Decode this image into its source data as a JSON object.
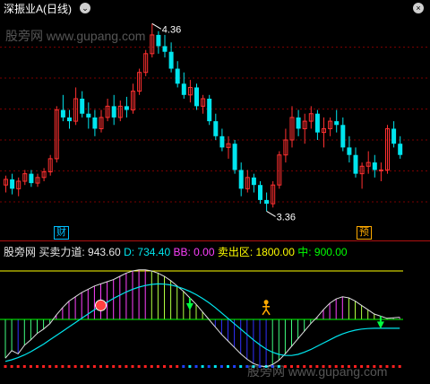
{
  "title": {
    "symbol": "深振业A",
    "period": "(日线)"
  },
  "watermark_top": "股旁网 www.gupang.com",
  "watermark_bottom": "股旁网 www.gupang.com",
  "price_chart": {
    "high_label": "4.36",
    "low_label": "3.36",
    "badge_left": "财",
    "badge_right": "预",
    "up_color": "#ff3030",
    "down_color": "#00e5ee"
  },
  "indicator": {
    "name": "股旁网",
    "label1": "买卖力道: 943.60",
    "label2": "D: 734.40",
    "label3": "BB: 0.00",
    "label4": "卖出区: 1800.00",
    "label5": "中: 900.00",
    "colors": {
      "label1": "#e6e6e6",
      "label2": "#00e5ee",
      "label3": "#ff40ff",
      "label4": "#ffff00",
      "label5": "#00ff00"
    }
  },
  "chart_data": [
    {
      "type": "candlestick",
      "title": "深振业A (日线)",
      "annotations": [
        {
          "text": "4.36",
          "label": "high"
        },
        {
          "text": "3.36",
          "label": "low"
        }
      ],
      "candles": [
        [
          3.5,
          3.55,
          3.46,
          3.53
        ],
        [
          3.53,
          3.56,
          3.45,
          3.48
        ],
        [
          3.48,
          3.54,
          3.44,
          3.52
        ],
        [
          3.52,
          3.58,
          3.5,
          3.56
        ],
        [
          3.56,
          3.58,
          3.49,
          3.51
        ],
        [
          3.51,
          3.56,
          3.49,
          3.54
        ],
        [
          3.54,
          3.59,
          3.52,
          3.57
        ],
        [
          3.57,
          3.66,
          3.55,
          3.64
        ],
        [
          3.64,
          3.92,
          3.62,
          3.9
        ],
        [
          3.9,
          3.98,
          3.84,
          3.86
        ],
        [
          3.86,
          3.9,
          3.8,
          3.84
        ],
        [
          3.84,
          4.02,
          3.82,
          3.96
        ],
        [
          3.96,
          4.0,
          3.86,
          3.88
        ],
        [
          3.88,
          3.94,
          3.8,
          3.86
        ],
        [
          3.86,
          3.9,
          3.76,
          3.8
        ],
        [
          3.8,
          3.9,
          3.78,
          3.86
        ],
        [
          3.86,
          3.96,
          3.84,
          3.92
        ],
        [
          3.92,
          3.98,
          3.82,
          3.86
        ],
        [
          3.86,
          3.95,
          3.84,
          3.92
        ],
        [
          3.92,
          3.97,
          3.86,
          3.9
        ],
        [
          3.9,
          4.04,
          3.88,
          4.0
        ],
        [
          4.0,
          4.12,
          3.98,
          4.1
        ],
        [
          4.1,
          4.22,
          4.08,
          4.2
        ],
        [
          4.2,
          4.36,
          4.18,
          4.3
        ],
        [
          4.3,
          4.32,
          4.2,
          4.24
        ],
        [
          4.24,
          4.3,
          4.18,
          4.21
        ],
        [
          4.21,
          4.26,
          4.1,
          4.12
        ],
        [
          4.12,
          4.16,
          4.02,
          4.04
        ],
        [
          4.04,
          4.1,
          3.96,
          3.98
        ],
        [
          3.98,
          4.06,
          3.94,
          4.02
        ],
        [
          4.02,
          4.04,
          3.9,
          3.92
        ],
        [
          3.92,
          3.98,
          3.88,
          3.96
        ],
        [
          3.96,
          3.98,
          3.82,
          3.84
        ],
        [
          3.84,
          3.88,
          3.74,
          3.76
        ],
        [
          3.76,
          3.8,
          3.68,
          3.7
        ],
        [
          3.7,
          3.76,
          3.64,
          3.72
        ],
        [
          3.72,
          3.74,
          3.56,
          3.58
        ],
        [
          3.58,
          3.62,
          3.44,
          3.48
        ],
        [
          3.48,
          3.58,
          3.46,
          3.54
        ],
        [
          3.54,
          3.56,
          3.46,
          3.5
        ],
        [
          3.5,
          3.52,
          3.4,
          3.42
        ],
        [
          3.42,
          3.46,
          3.36,
          3.4
        ],
        [
          3.4,
          3.52,
          3.38,
          3.5
        ],
        [
          3.5,
          3.68,
          3.48,
          3.66
        ],
        [
          3.66,
          3.8,
          3.62,
          3.74
        ],
        [
          3.74,
          3.92,
          3.7,
          3.86
        ],
        [
          3.86,
          3.9,
          3.76,
          3.8
        ],
        [
          3.8,
          3.88,
          3.72,
          3.84
        ],
        [
          3.84,
          3.92,
          3.8,
          3.88
        ],
        [
          3.88,
          3.9,
          3.74,
          3.78
        ],
        [
          3.78,
          3.86,
          3.7,
          3.8
        ],
        [
          3.8,
          3.86,
          3.76,
          3.84
        ],
        [
          3.84,
          3.9,
          3.78,
          3.82
        ],
        [
          3.82,
          3.86,
          3.68,
          3.7
        ],
        [
          3.7,
          3.76,
          3.62,
          3.66
        ],
        [
          3.66,
          3.7,
          3.54,
          3.56
        ],
        [
          3.56,
          3.62,
          3.48,
          3.6
        ],
        [
          3.6,
          3.68,
          3.56,
          3.62
        ],
        [
          3.62,
          3.66,
          3.54,
          3.58
        ],
        [
          3.58,
          3.62,
          3.52,
          3.58
        ],
        [
          3.58,
          3.82,
          3.56,
          3.8
        ],
        [
          3.8,
          3.84,
          3.7,
          3.72
        ],
        [
          3.72,
          3.76,
          3.64,
          3.66
        ]
      ]
    },
    {
      "type": "bar",
      "title": "股旁网",
      "series": [
        {
          "name": "买卖力道",
          "values": [
            180,
            320,
            260,
            420,
            520,
            640,
            720,
            820,
            980,
            1120,
            1240,
            1320,
            1400,
            1460,
            1520,
            1560,
            1600,
            1640,
            1700,
            1760,
            1800,
            1820,
            1820,
            1800,
            1760,
            1700,
            1620,
            1520,
            1420,
            1300,
            1180,
            1040,
            900,
            760,
            620,
            500,
            380,
            260,
            160,
            80,
            40,
            20,
            60,
            140,
            260,
            400,
            540,
            680,
            820,
            940,
            1080,
            1200,
            1280,
            1320,
            1300,
            1240,
            1160,
            1080,
            1000,
            960,
            920,
            930,
            940
          ]
        },
        {
          "name": "D",
          "values": [
            120,
            150,
            190,
            240,
            300,
            370,
            440,
            520,
            600,
            680,
            760,
            840,
            920,
            1000,
            1080,
            1150,
            1220,
            1290,
            1350,
            1410,
            1460,
            1500,
            1530,
            1550,
            1560,
            1555,
            1540,
            1510,
            1470,
            1420,
            1360,
            1290,
            1210,
            1120,
            1020,
            920,
            820,
            720,
            620,
            520,
            430,
            350,
            290,
            250,
            230,
            230,
            250,
            290,
            340,
            400,
            460,
            520,
            580,
            630,
            670,
            700,
            720,
            730,
            735,
            735,
            735,
            735,
            735
          ]
        }
      ],
      "levels": {
        "卖出区": 1800.0,
        "中": 900.0
      }
    }
  ]
}
